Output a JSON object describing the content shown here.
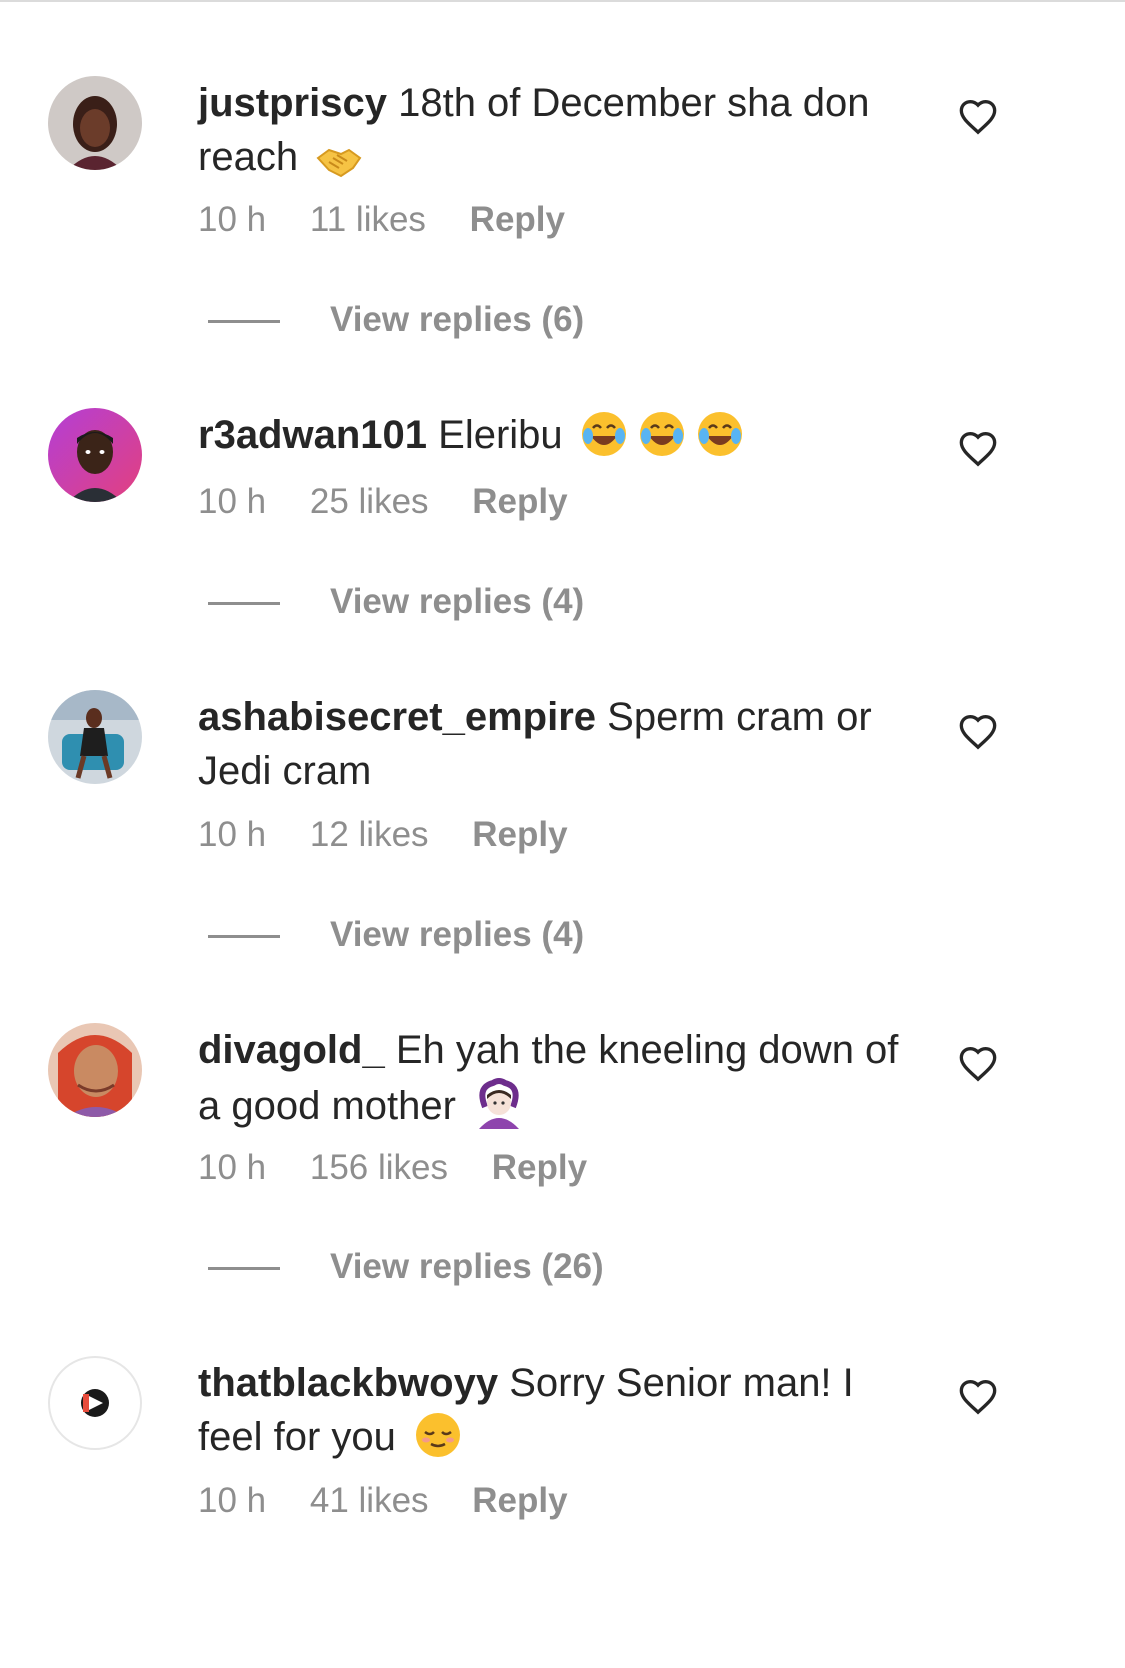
{
  "comments": [
    {
      "username": "justpriscy",
      "text": "18th of December sha don reach",
      "emoji": "handshake",
      "time": "10 h",
      "likes": "11 likes",
      "reply": "Reply",
      "view_replies": "View replies (6)"
    },
    {
      "username": "r3adwan101",
      "text": "Eleribu",
      "emoji": "tears-of-joy x3",
      "time": "10 h",
      "likes": "25 likes",
      "reply": "Reply",
      "view_replies": "View replies (4)"
    },
    {
      "username": "ashabisecret_empire",
      "text": "Sperm cram or Jedi cram",
      "time": "10 h",
      "likes": "12 likes",
      "reply": "Reply",
      "view_replies": "View replies (4)"
    },
    {
      "username": "divagold_",
      "text": "Eh yah the kneeling down of a good mother",
      "emoji": "person-gesturing-ok",
      "time": "10 h",
      "likes": "156 likes",
      "reply": "Reply",
      "view_replies": "View replies (26)"
    },
    {
      "username": "thatblackbwoyy",
      "text": "Sorry Senior man! I feel for you",
      "emoji": "relieved-face",
      "time": "10 h",
      "likes": "41 likes",
      "reply": "Reply"
    }
  ],
  "colors": {
    "text": "#262626",
    "secondary": "#8e8e8e"
  },
  "icons": [
    "heart-icon",
    "avatar"
  ]
}
